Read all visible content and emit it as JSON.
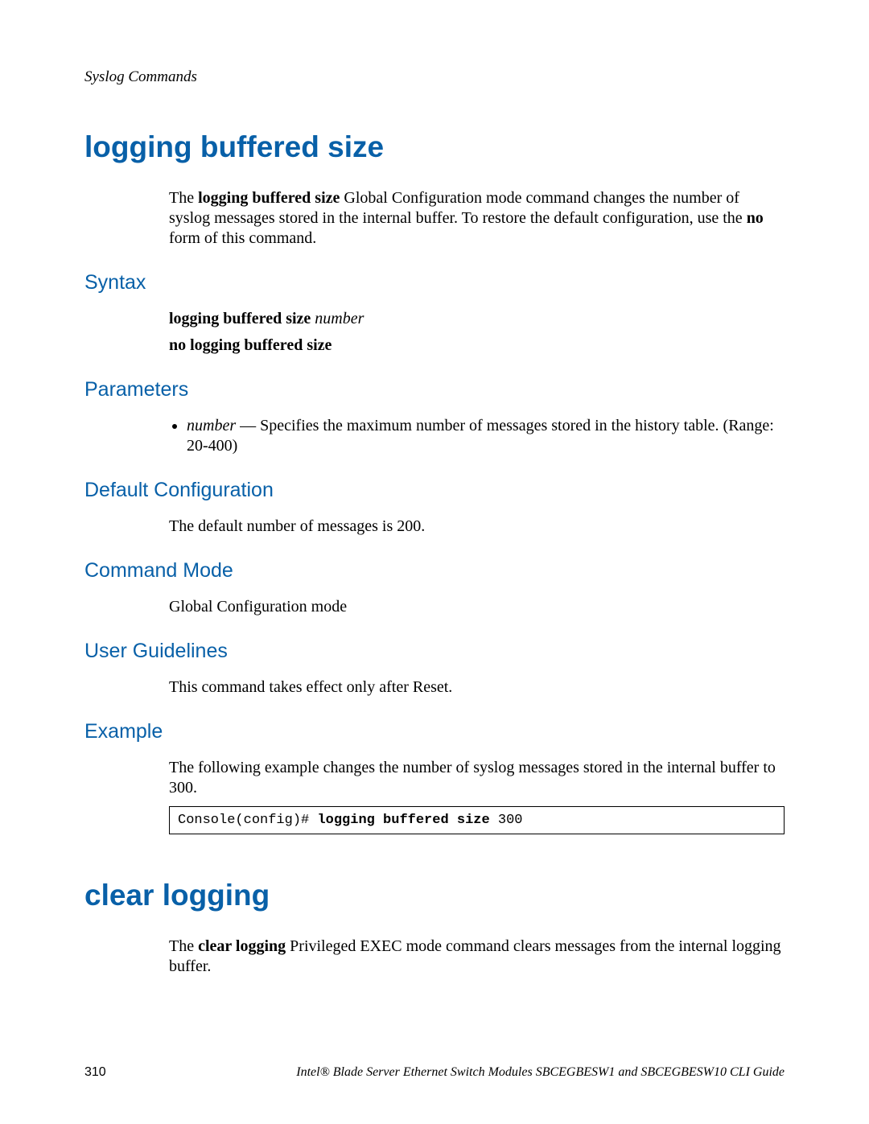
{
  "header": {
    "running": "Syslog Commands"
  },
  "section1": {
    "title": "logging buffered size",
    "intro": {
      "pre": "The ",
      "bold1": "logging buffered size",
      "mid": " Global Configuration mode command changes the number of syslog messages stored in the internal buffer. To restore the default configuration, use the ",
      "bold2": "no",
      "post": " form of this command."
    },
    "syntax": {
      "heading": "Syntax",
      "line1_bold": "logging buffered size ",
      "line1_ital": "number",
      "line2_bold": "no logging buffered size"
    },
    "parameters": {
      "heading": "Parameters",
      "item1_ital": "number",
      "item1_rest": " — Specifies the maximum number of messages stored in the history table. (Range: 20-400)"
    },
    "defaultcfg": {
      "heading": "Default Configuration",
      "text": "The default number of messages is 200."
    },
    "cmdmode": {
      "heading": "Command Mode",
      "text": "Global Configuration mode"
    },
    "guidelines": {
      "heading": "User Guidelines",
      "text": "This command takes effect only after Reset."
    },
    "example": {
      "heading": "Example",
      "text": "The following example changes the number of syslog messages stored in the internal buffer to 300.",
      "code_prefix": "Console(config)# ",
      "code_bold": "logging buffered size",
      "code_suffix": " 300"
    }
  },
  "section2": {
    "title": "clear logging",
    "intro": {
      "pre": "The ",
      "bold1": "clear logging",
      "post": " Privileged EXEC mode command clears messages from the internal logging buffer."
    }
  },
  "footer": {
    "page": "310",
    "guide": "Intel® Blade Server Ethernet Switch Modules SBCEGBESW1 and SBCEGBESW10 CLI Guide"
  }
}
